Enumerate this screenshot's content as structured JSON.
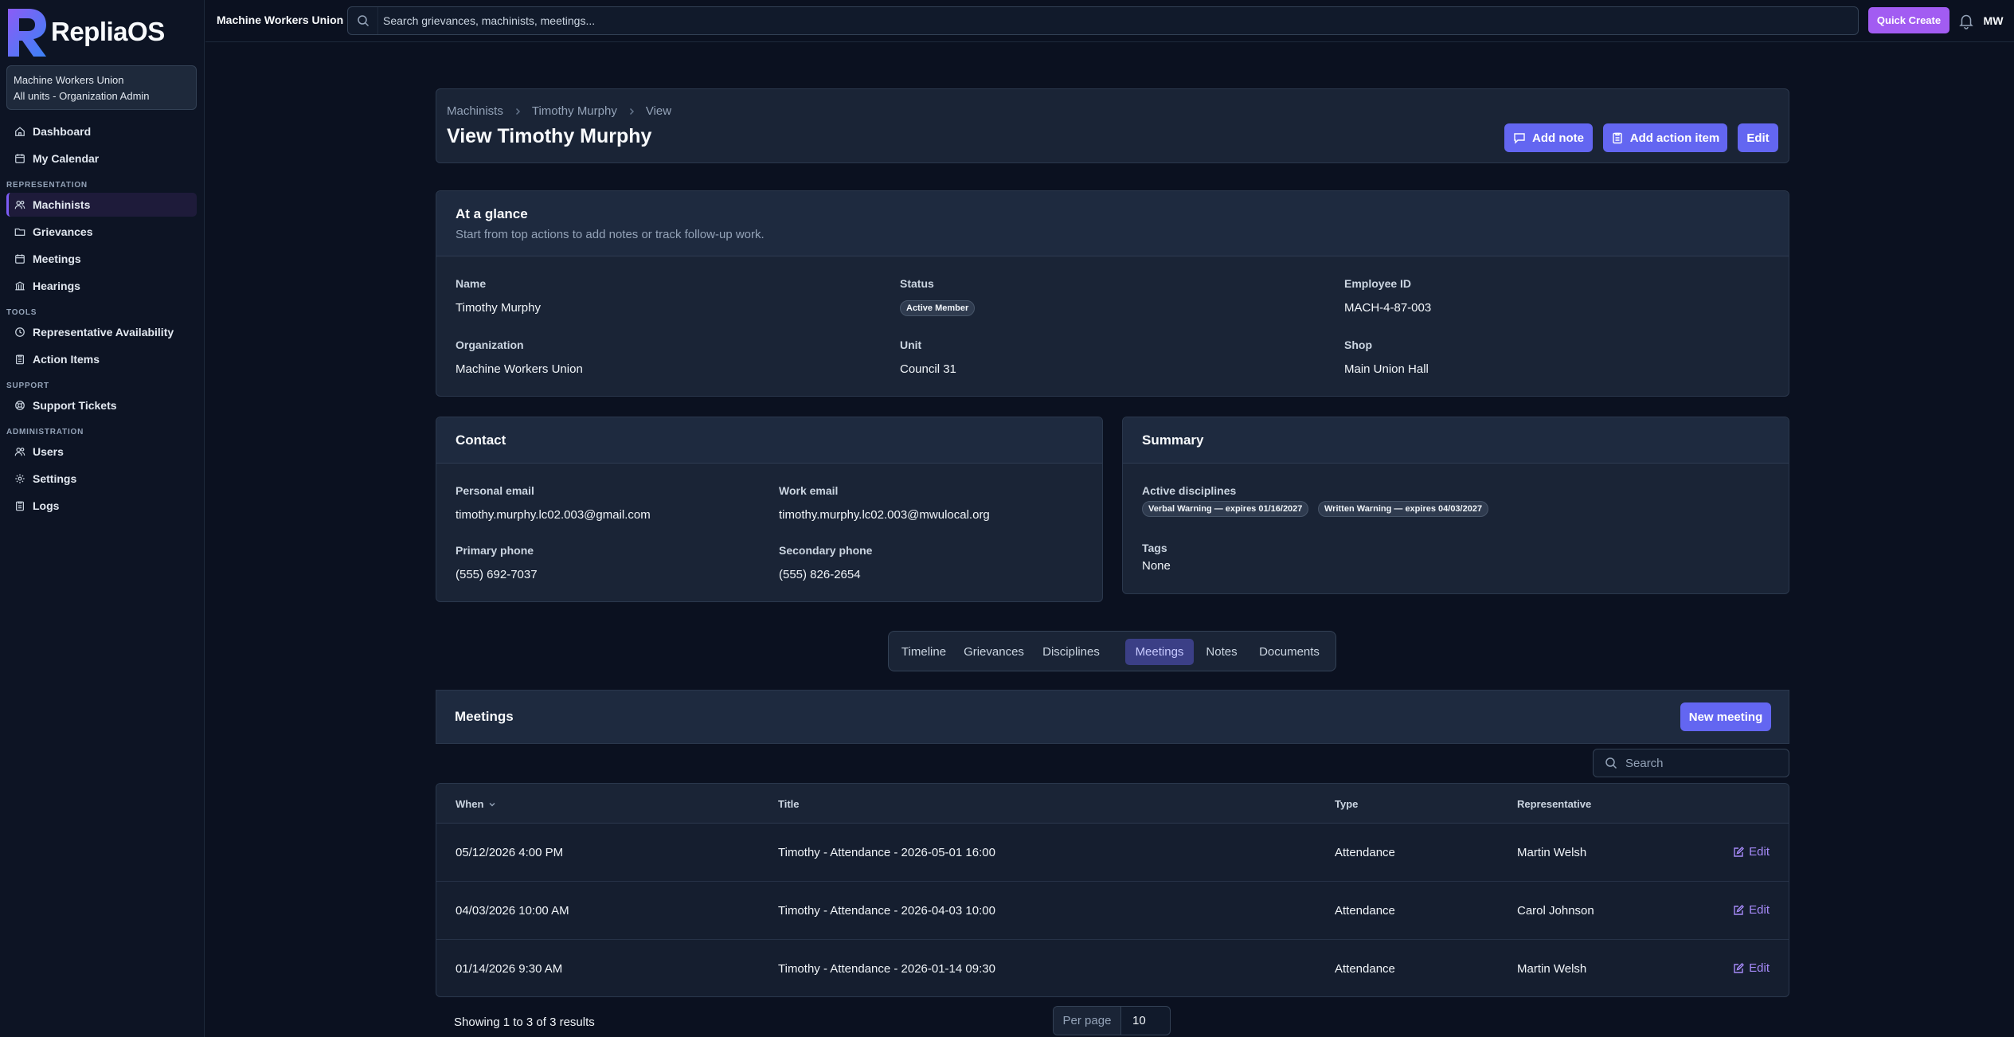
{
  "app": {
    "name": "RepliaOS",
    "org_name": "Machine Workers Union",
    "org_scope": "All units - Organization Admin"
  },
  "sidebar": {
    "top_items": [
      {
        "label": "Dashboard",
        "icon": "home-icon"
      },
      {
        "label": "My Calendar",
        "icon": "calendar-icon"
      }
    ],
    "sections": [
      {
        "title": "REPRESENTATION",
        "items": [
          {
            "label": "Machinists",
            "icon": "users-icon",
            "active": true
          },
          {
            "label": "Grievances",
            "icon": "folder-icon"
          },
          {
            "label": "Meetings",
            "icon": "calendar-icon"
          },
          {
            "label": "Hearings",
            "icon": "building-icon"
          }
        ]
      },
      {
        "title": "TOOLS",
        "items": [
          {
            "label": "Representative Availability",
            "icon": "clock-icon"
          },
          {
            "label": "Action Items",
            "icon": "clipboard-icon"
          }
        ]
      },
      {
        "title": "SUPPORT",
        "items": [
          {
            "label": "Support Tickets",
            "icon": "lifebuoy-icon"
          }
        ]
      },
      {
        "title": "ADMINISTRATION",
        "items": [
          {
            "label": "Users",
            "icon": "users-icon"
          },
          {
            "label": "Settings",
            "icon": "gear-icon"
          },
          {
            "label": "Logs",
            "icon": "clipboard-icon"
          }
        ]
      }
    ]
  },
  "topbar": {
    "org": "Machine Workers Union",
    "search_placeholder": "Search grievances, machinists, meetings...",
    "quick_create": "Quick Create",
    "avatar_initials": "MW"
  },
  "header": {
    "breadcrumb": [
      "Machinists",
      "Timothy Murphy",
      "View"
    ],
    "title": "View Timothy Murphy",
    "buttons": {
      "add_note": "Add note",
      "add_action_item": "Add action item",
      "edit": "Edit"
    }
  },
  "glance": {
    "title": "At a glance",
    "subtitle": "Start from top actions to add notes or track follow-up work.",
    "fields": {
      "name_label": "Name",
      "name": "Timothy Murphy",
      "status_label": "Status",
      "status": "Active Member",
      "employee_id_label": "Employee ID",
      "employee_id": "MACH-4-87-003",
      "organization_label": "Organization",
      "organization": "Machine Workers Union",
      "unit_label": "Unit",
      "unit": "Council 31",
      "shop_label": "Shop",
      "shop": "Main Union Hall"
    }
  },
  "contact": {
    "title": "Contact",
    "personal_email_label": "Personal email",
    "personal_email": "timothy.murphy.lc02.003@gmail.com",
    "work_email_label": "Work email",
    "work_email": "timothy.murphy.lc02.003@mwulocal.org",
    "primary_phone_label": "Primary phone",
    "primary_phone": "(555) 692-7037",
    "secondary_phone_label": "Secondary phone",
    "secondary_phone": "(555) 826-2654"
  },
  "summary": {
    "title": "Summary",
    "disciplines_label": "Active disciplines",
    "disciplines": [
      "Verbal Warning — expires 01/16/2027",
      "Written Warning — expires 04/03/2027"
    ],
    "tags_label": "Tags",
    "tags": "None"
  },
  "tabs": {
    "items": [
      "Timeline",
      "Grievances",
      "Disciplines",
      "Meetings",
      "Notes",
      "Documents"
    ],
    "active": "Meetings"
  },
  "meetings": {
    "title": "Meetings",
    "new_button": "New meeting",
    "search_placeholder": "Search",
    "columns": {
      "when": "When",
      "title": "Title",
      "type": "Type",
      "representative": "Representative"
    },
    "rows": [
      {
        "when": "05/12/2026 4:00 PM",
        "title": "Timothy - Attendance - 2026-05-01 16:00",
        "type": "Attendance",
        "representative": "Martin Welsh",
        "action": "Edit"
      },
      {
        "when": "04/03/2026 10:00 AM",
        "title": "Timothy - Attendance - 2026-04-03 10:00",
        "type": "Attendance",
        "representative": "Carol Johnson",
        "action": "Edit"
      },
      {
        "when": "01/14/2026 9:30 AM",
        "title": "Timothy - Attendance - 2026-01-14 09:30",
        "type": "Attendance",
        "representative": "Martin Welsh",
        "action": "Edit"
      }
    ],
    "showing": "Showing 1 to 3 of 3 results",
    "per_page_label": "Per page",
    "per_page": "10"
  },
  "colors": {
    "accent": "#6366f1",
    "quick_create": "#a25cf2",
    "link": "#a78bfa"
  }
}
